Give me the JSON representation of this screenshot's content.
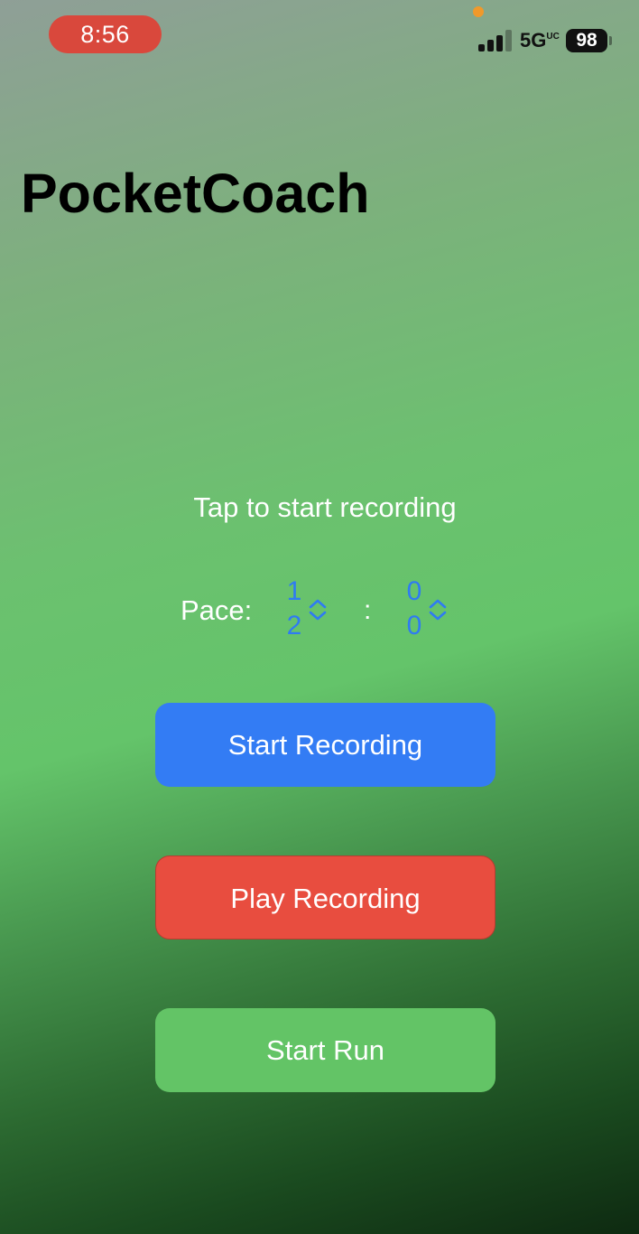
{
  "status_bar": {
    "time": "8:56",
    "network": "5G",
    "network_suffix": "UC",
    "battery": "98",
    "colors": {
      "time_pill": "#d9483c",
      "mic_indicator": "#f0992b"
    },
    "signal_icon": "cellular-signal-icon",
    "battery_icon": "battery-icon"
  },
  "app": {
    "title": "PocketCoach",
    "instruction": "Tap to start recording"
  },
  "pace": {
    "label": "Pace:",
    "separator": ":",
    "minutes_digits": [
      "1",
      "2"
    ],
    "seconds_digits": [
      "0",
      "0"
    ],
    "stepper_icon": "chevron-up-down-icon",
    "color": "#2f7bf2"
  },
  "buttons": {
    "start_recording": {
      "label": "Start Recording",
      "color": "#337cf4"
    },
    "play_recording": {
      "label": "Play Recording",
      "color": "#e84d3f"
    },
    "start_run": {
      "label": "Start Run",
      "color": "#63c466"
    }
  }
}
